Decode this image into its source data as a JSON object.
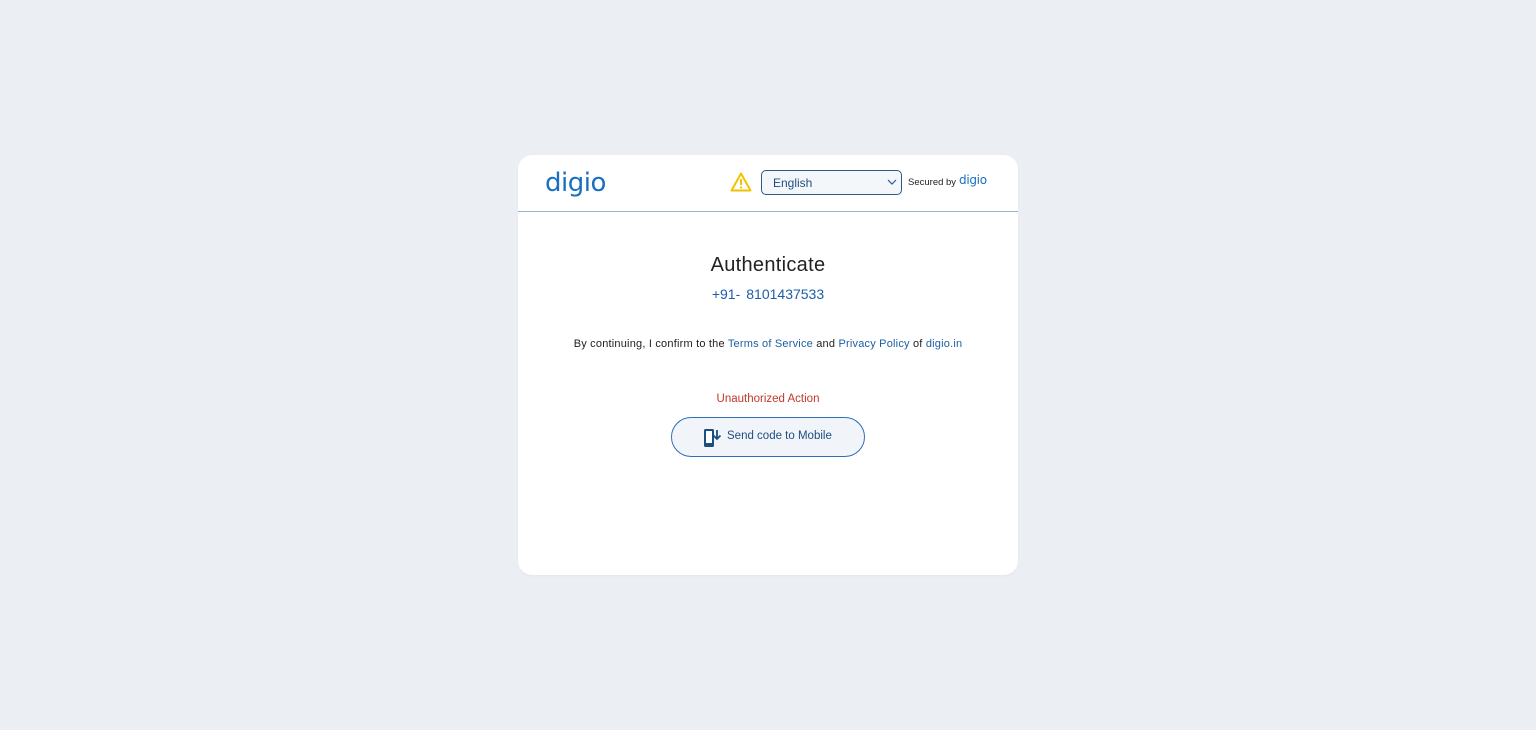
{
  "header": {
    "logo_text": "digio",
    "language": {
      "selected": "English"
    },
    "secured_by_label": "Secured by",
    "secured_by_logo": "digio"
  },
  "main": {
    "title": "Authenticate",
    "phone": {
      "country_code": "+91-",
      "number": "8101437533"
    },
    "consent": {
      "prefix": "By continuing, I confirm to the",
      "terms_link": "Terms of Service",
      "and": "and",
      "privacy_link": "Privacy Policy",
      "of": "of",
      "site_link": "digio.in"
    },
    "error_text": "Unauthorized Action",
    "send_button_label": "Send code to Mobile"
  },
  "icons": {
    "warning": "warning-icon",
    "chevron": "chevron-down-icon",
    "send": "mobile-download-icon"
  },
  "colors": {
    "background": "#ebeff3",
    "brand_blue": "#1a6fc0",
    "link_blue": "#1c5ea8",
    "error_red": "#c0392b",
    "warning_yellow": "#f2c200"
  }
}
